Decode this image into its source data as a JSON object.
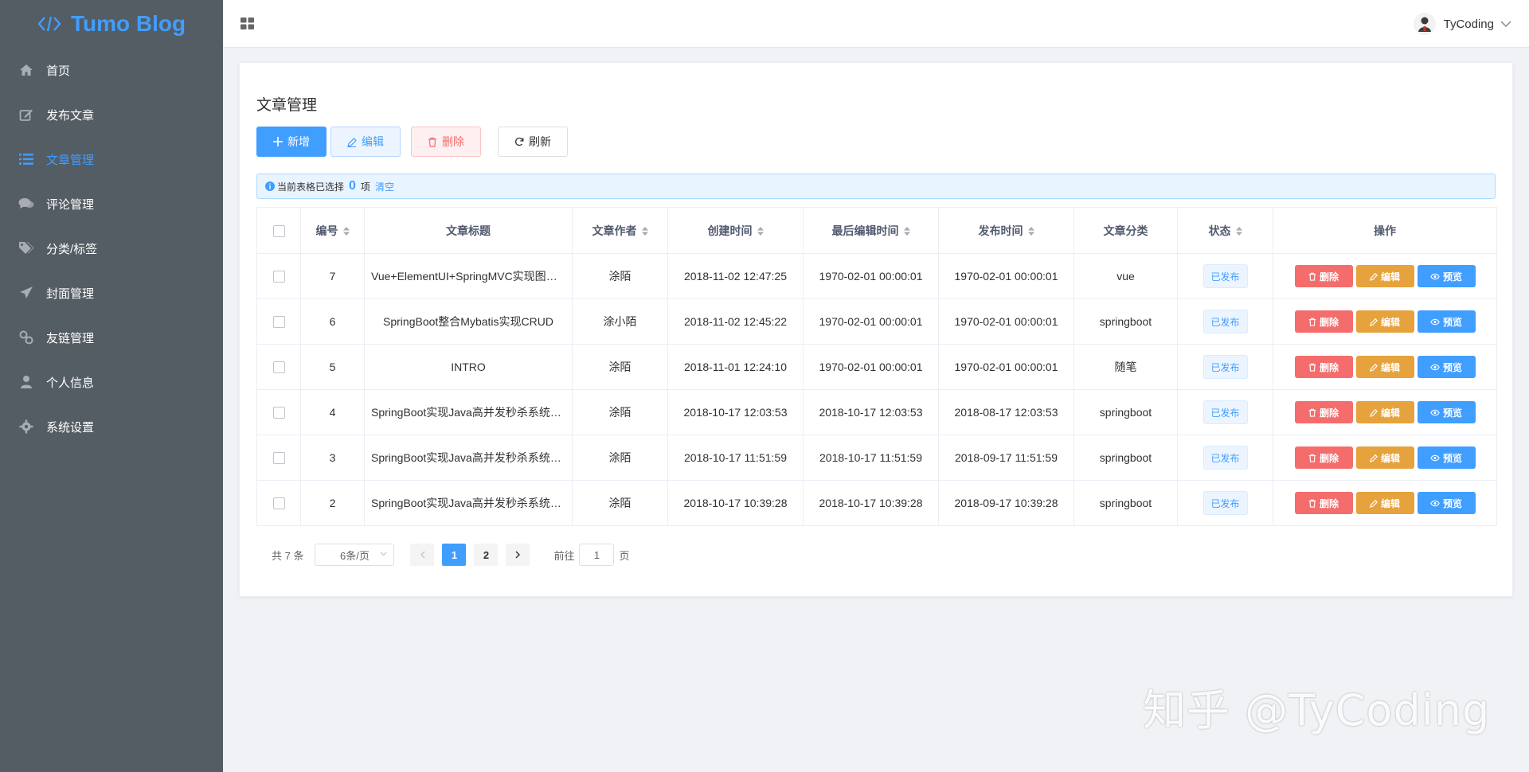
{
  "app": {
    "name": "Tumo Blog"
  },
  "sidebar": {
    "items": [
      {
        "label": "首页",
        "icon": "home-icon"
      },
      {
        "label": "发布文章",
        "icon": "edit-icon"
      },
      {
        "label": "文章管理",
        "icon": "list-icon",
        "active": true
      },
      {
        "label": "评论管理",
        "icon": "comments-icon"
      },
      {
        "label": "分类/标签",
        "icon": "tags-icon"
      },
      {
        "label": "封面管理",
        "icon": "send-icon"
      },
      {
        "label": "友链管理",
        "icon": "link-icon"
      },
      {
        "label": "个人信息",
        "icon": "user-icon"
      },
      {
        "label": "系统设置",
        "icon": "gear-icon"
      }
    ]
  },
  "header": {
    "username": "TyCoding"
  },
  "main": {
    "title": "文章管理",
    "toolbar": {
      "add": "新增",
      "edit": "编辑",
      "delete": "删除",
      "refresh": "刷新"
    },
    "selection": {
      "prefix": "当前表格已选择",
      "count": "0",
      "suffix": "项",
      "clear": "清空"
    },
    "table": {
      "columns": [
        "编号",
        "文章标题",
        "文章作者",
        "创建时间",
        "最后编辑时间",
        "发布时间",
        "文章分类",
        "状态",
        "操作"
      ],
      "rows": [
        {
          "id": "7",
          "title": "Vue+ElementUI+SpringMVC实现图片上传",
          "author": "涂陌",
          "created": "2018-11-02 12:47:25",
          "edited": "1970-02-01 00:00:01",
          "published": "1970-02-01 00:00:01",
          "category": "vue",
          "status": "已发布"
        },
        {
          "id": "6",
          "title": "SpringBoot整合Mybatis实现CRUD",
          "author": "涂小陌",
          "created": "2018-11-02 12:45:22",
          "edited": "1970-02-01 00:00:01",
          "published": "1970-02-01 00:00:01",
          "category": "springboot",
          "status": "已发布"
        },
        {
          "id": "5",
          "title": "INTRO",
          "author": "涂陌",
          "created": "2018-11-01 12:24:10",
          "edited": "1970-02-01 00:00:01",
          "published": "1970-02-01 00:00:01",
          "category": "随笔",
          "status": "已发布"
        },
        {
          "id": "4",
          "title": "SpringBoot实现Java高并发秒杀系统之DAO层",
          "author": "涂陌",
          "created": "2018-10-17 12:03:53",
          "edited": "2018-10-17 12:03:53",
          "published": "2018-08-17 12:03:53",
          "category": "springboot",
          "status": "已发布"
        },
        {
          "id": "3",
          "title": "SpringBoot实现Java高并发秒杀系统之Service层",
          "author": "涂陌",
          "created": "2018-10-17 11:51:59",
          "edited": "2018-10-17 11:51:59",
          "published": "2018-09-17 11:51:59",
          "category": "springboot",
          "status": "已发布"
        },
        {
          "id": "2",
          "title": "SpringBoot实现Java高并发秒杀系统之Web层",
          "author": "涂陌",
          "created": "2018-10-17 10:39:28",
          "edited": "2018-10-17 10:39:28",
          "published": "2018-09-17 10:39:28",
          "category": "springboot",
          "status": "已发布"
        }
      ],
      "actions": {
        "delete": "删除",
        "edit": "编辑",
        "preview": "预览"
      }
    },
    "pagination": {
      "total": "共 7 条",
      "page_size": "6条/页",
      "pages": [
        "1",
        "2"
      ],
      "current": "1",
      "goto_prefix": "前往",
      "goto_value": "1",
      "goto_suffix": "页"
    }
  },
  "watermark": "知乎 @TyCoding",
  "colors": {
    "primary": "#409eff",
    "danger": "#f56c6c",
    "warning": "#e6a23c",
    "sidebar": "#545c64"
  }
}
